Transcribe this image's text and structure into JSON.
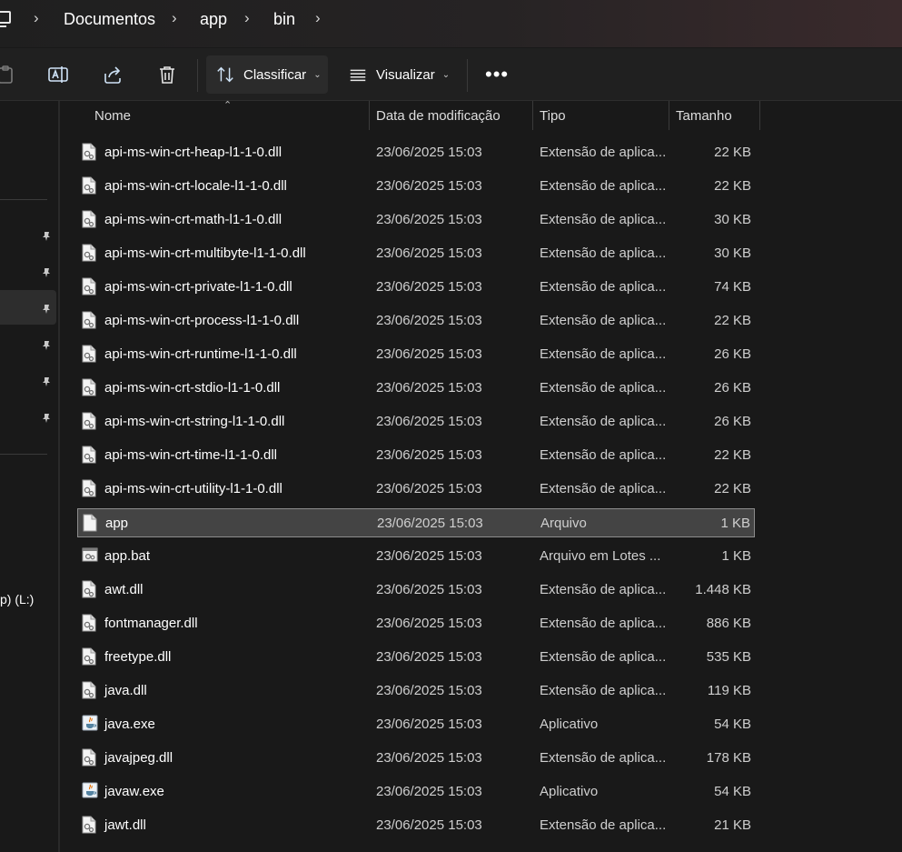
{
  "breadcrumb": {
    "items": [
      "Documentos",
      "app",
      "bin"
    ],
    "root_icon": "computer-icon"
  },
  "toolbar": {
    "sort_label": "Classificar",
    "view_label": "Visualizar",
    "more_label": "•••",
    "icons": [
      "paste-icon",
      "rename-icon",
      "share-icon",
      "delete-icon",
      "sort-icon",
      "view-icon"
    ]
  },
  "navpane": {
    "drive_label": "p) (L:)",
    "pinned_count": 6
  },
  "columns": {
    "name": "Nome",
    "modified": "Data de modificação",
    "type": "Tipo",
    "size": "Tamanho"
  },
  "files": [
    {
      "name": "api-ms-win-crt-heap-l1-1-0.dll",
      "modified": "23/06/2025 15:03",
      "type": "Extensão de aplica...",
      "size": "22 KB",
      "icon": "dll-file-icon"
    },
    {
      "name": "api-ms-win-crt-locale-l1-1-0.dll",
      "modified": "23/06/2025 15:03",
      "type": "Extensão de aplica...",
      "size": "22 KB",
      "icon": "dll-file-icon"
    },
    {
      "name": "api-ms-win-crt-math-l1-1-0.dll",
      "modified": "23/06/2025 15:03",
      "type": "Extensão de aplica...",
      "size": "30 KB",
      "icon": "dll-file-icon"
    },
    {
      "name": "api-ms-win-crt-multibyte-l1-1-0.dll",
      "modified": "23/06/2025 15:03",
      "type": "Extensão de aplica...",
      "size": "30 KB",
      "icon": "dll-file-icon"
    },
    {
      "name": "api-ms-win-crt-private-l1-1-0.dll",
      "modified": "23/06/2025 15:03",
      "type": "Extensão de aplica...",
      "size": "74 KB",
      "icon": "dll-file-icon"
    },
    {
      "name": "api-ms-win-crt-process-l1-1-0.dll",
      "modified": "23/06/2025 15:03",
      "type": "Extensão de aplica...",
      "size": "22 KB",
      "icon": "dll-file-icon"
    },
    {
      "name": "api-ms-win-crt-runtime-l1-1-0.dll",
      "modified": "23/06/2025 15:03",
      "type": "Extensão de aplica...",
      "size": "26 KB",
      "icon": "dll-file-icon"
    },
    {
      "name": "api-ms-win-crt-stdio-l1-1-0.dll",
      "modified": "23/06/2025 15:03",
      "type": "Extensão de aplica...",
      "size": "26 KB",
      "icon": "dll-file-icon"
    },
    {
      "name": "api-ms-win-crt-string-l1-1-0.dll",
      "modified": "23/06/2025 15:03",
      "type": "Extensão de aplica...",
      "size": "26 KB",
      "icon": "dll-file-icon"
    },
    {
      "name": "api-ms-win-crt-time-l1-1-0.dll",
      "modified": "23/06/2025 15:03",
      "type": "Extensão de aplica...",
      "size": "22 KB",
      "icon": "dll-file-icon"
    },
    {
      "name": "api-ms-win-crt-utility-l1-1-0.dll",
      "modified": "23/06/2025 15:03",
      "type": "Extensão de aplica...",
      "size": "22 KB",
      "icon": "dll-file-icon"
    },
    {
      "name": "app",
      "modified": "23/06/2025 15:03",
      "type": "Arquivo",
      "size": "1 KB",
      "icon": "blank-file-icon",
      "selected": true
    },
    {
      "name": "app.bat",
      "modified": "23/06/2025 15:03",
      "type": "Arquivo em Lotes ...",
      "size": "1 KB",
      "icon": "batch-file-icon"
    },
    {
      "name": "awt.dll",
      "modified": "23/06/2025 15:03",
      "type": "Extensão de aplica...",
      "size": "1.448 KB",
      "icon": "dll-file-icon"
    },
    {
      "name": "fontmanager.dll",
      "modified": "23/06/2025 15:03",
      "type": "Extensão de aplica...",
      "size": "886 KB",
      "icon": "dll-file-icon"
    },
    {
      "name": "freetype.dll",
      "modified": "23/06/2025 15:03",
      "type": "Extensão de aplica...",
      "size": "535 KB",
      "icon": "dll-file-icon"
    },
    {
      "name": "java.dll",
      "modified": "23/06/2025 15:03",
      "type": "Extensão de aplica...",
      "size": "119 KB",
      "icon": "dll-file-icon"
    },
    {
      "name": "java.exe",
      "modified": "23/06/2025 15:03",
      "type": "Aplicativo",
      "size": "54 KB",
      "icon": "java-app-icon"
    },
    {
      "name": "javajpeg.dll",
      "modified": "23/06/2025 15:03",
      "type": "Extensão de aplica...",
      "size": "178 KB",
      "icon": "dll-file-icon"
    },
    {
      "name": "javaw.exe",
      "modified": "23/06/2025 15:03",
      "type": "Aplicativo",
      "size": "54 KB",
      "icon": "java-app-icon"
    },
    {
      "name": "jawt.dll",
      "modified": "23/06/2025 15:03",
      "type": "Extensão de aplica...",
      "size": "21 KB",
      "icon": "dll-file-icon"
    }
  ],
  "colors": {
    "background": "#191919",
    "toolbar": "#202020",
    "selection": "#444444",
    "accent": "#cfe3f7"
  }
}
